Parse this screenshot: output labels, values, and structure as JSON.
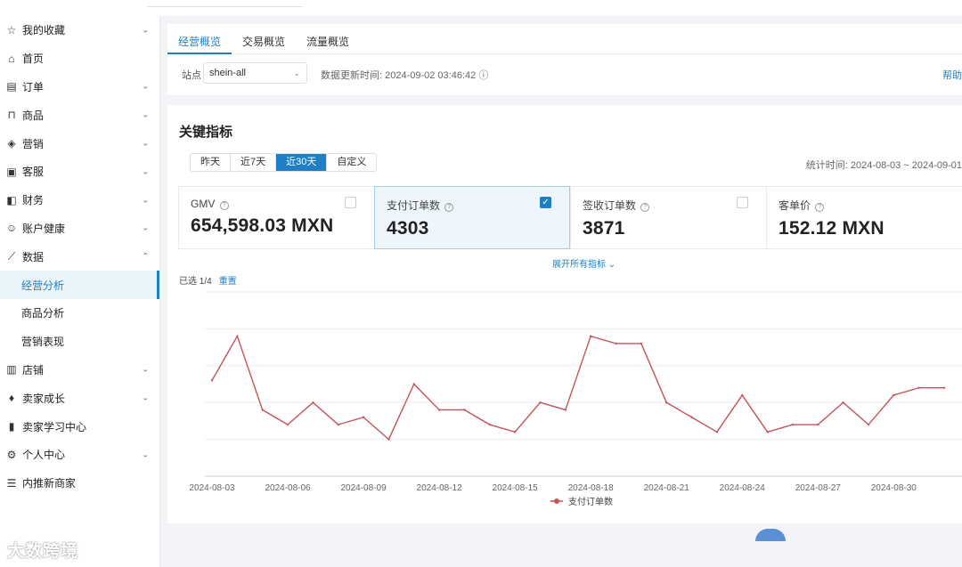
{
  "sidebar": {
    "items": [
      {
        "label": "我的收藏",
        "icon": "star-icon",
        "glyph": "☆",
        "chevron": "⌄"
      },
      {
        "label": "首页",
        "icon": "home-icon",
        "glyph": "⌂",
        "chevron": ""
      },
      {
        "label": "订单",
        "icon": "order-icon",
        "glyph": "▤",
        "chevron": "⌄"
      },
      {
        "label": "商品",
        "icon": "bag-icon",
        "glyph": "⊓",
        "chevron": "⌄"
      },
      {
        "label": "营销",
        "icon": "tag-icon",
        "glyph": "◈",
        "chevron": "⌄"
      },
      {
        "label": "客服",
        "icon": "chat-icon",
        "glyph": "▣",
        "chevron": "⌄"
      },
      {
        "label": "财务",
        "icon": "wallet-icon",
        "glyph": "◧",
        "chevron": "⌄"
      },
      {
        "label": "账户健康",
        "icon": "health-icon",
        "glyph": "☺",
        "chevron": "⌄"
      },
      {
        "label": "数据",
        "icon": "chart-icon",
        "glyph": "⟋",
        "chevron": "⌃"
      },
      {
        "label": "经营分析",
        "sub": true,
        "active": true
      },
      {
        "label": "商品分析",
        "sub": true
      },
      {
        "label": "营销表现",
        "sub": true
      },
      {
        "label": "店铺",
        "icon": "store-icon",
        "glyph": "▥",
        "chevron": "⌄"
      },
      {
        "label": "卖家成长",
        "icon": "growth-icon",
        "glyph": "♦",
        "chevron": "⌄"
      },
      {
        "label": "卖家学习中心",
        "icon": "book-icon",
        "glyph": "▮",
        "chevron": ""
      },
      {
        "label": "个人中心",
        "icon": "gear-icon",
        "glyph": "⚙",
        "chevron": "⌄"
      },
      {
        "label": "内推新商家",
        "icon": "list-icon",
        "glyph": "☰",
        "chevron": ""
      }
    ]
  },
  "tabs": [
    "经营概览",
    "交易概览",
    "流量概览"
  ],
  "filter": {
    "site_label": "站点",
    "site_value": "shein-all",
    "update_text": "数据更新时间: 2024-09-02 03:46:42",
    "help_text": "帮助"
  },
  "key_metrics": {
    "title": "关键指标",
    "ranges": [
      "昨天",
      "近7天",
      "近30天",
      "自定义"
    ],
    "active_range": "近30天",
    "stat_period": "统计时间: 2024-08-03 ~ 2024-09-01",
    "metrics": [
      {
        "label": "GMV",
        "value": "654,598.03 MXN",
        "selected": false
      },
      {
        "label": "支付订单数",
        "value": "4303",
        "selected": true
      },
      {
        "label": "签收订单数",
        "value": "3871",
        "selected": false
      },
      {
        "label": "客单价",
        "value": "152.12 MXN",
        "selected": false
      }
    ],
    "expand_text": "展开所有指标",
    "selected_text": "已选 1/4",
    "reset_text": "重置"
  },
  "chart_data": {
    "type": "line",
    "x": [
      "2024-08-03",
      "2024-08-04",
      "2024-08-05",
      "2024-08-06",
      "2024-08-07",
      "2024-08-08",
      "2024-08-09",
      "2024-08-10",
      "2024-08-11",
      "2024-08-12",
      "2024-08-13",
      "2024-08-14",
      "2024-08-15",
      "2024-08-16",
      "2024-08-17",
      "2024-08-18",
      "2024-08-19",
      "2024-08-20",
      "2024-08-21",
      "2024-08-22",
      "2024-08-23",
      "2024-08-24",
      "2024-08-25",
      "2024-08-26",
      "2024-08-27",
      "2024-08-28",
      "2024-08-29",
      "2024-08-30",
      "2024-08-31",
      "2024-09-01"
    ],
    "tick_labels": [
      "2024-08-03",
      "2024-08-06",
      "2024-08-09",
      "2024-08-12",
      "2024-08-15",
      "2024-08-18",
      "2024-08-21",
      "2024-08-24",
      "2024-08-27",
      "2024-08-30"
    ],
    "series": [
      {
        "name": "支付订单数",
        "color": "#c4545c",
        "values": [
          130,
          190,
          90,
          70,
          100,
          70,
          80,
          50,
          125,
          90,
          90,
          70,
          60,
          100,
          90,
          190,
          180,
          180,
          100,
          80,
          60,
          110,
          60,
          70,
          70,
          100,
          70,
          110,
          120,
          120
        ]
      }
    ],
    "ylim": [
      0,
      250
    ],
    "grid": true,
    "legend": "bottom-center"
  },
  "watermark": "大数跨境"
}
